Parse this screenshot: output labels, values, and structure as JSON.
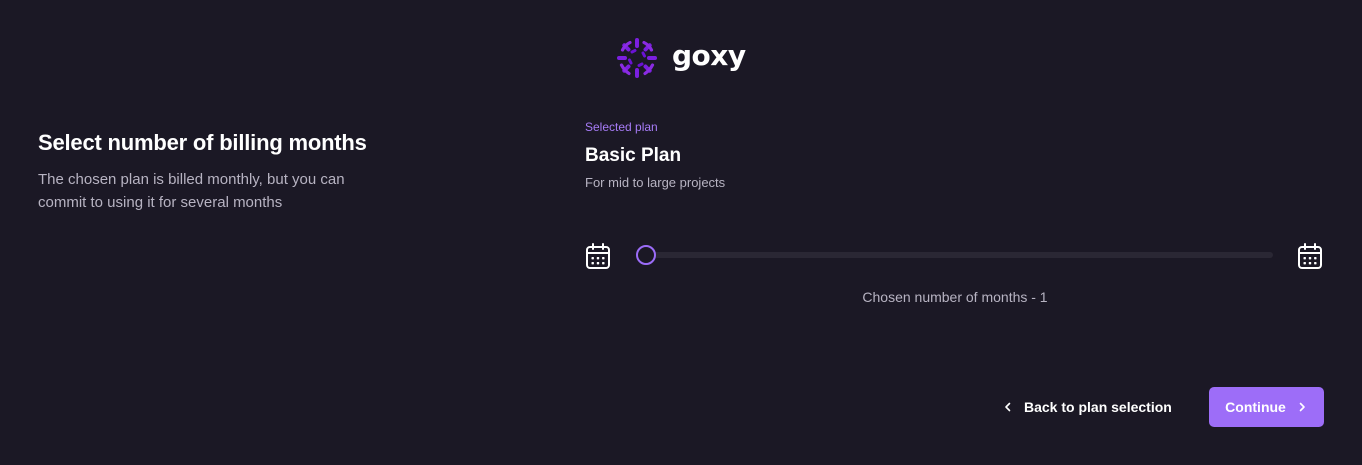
{
  "brand": {
    "name": "goxy",
    "logo_icon": "goxy-logo-icon",
    "accent_color": "#8b5cf6"
  },
  "intro": {
    "title": "Select number of billing months",
    "description": "The chosen plan is billed monthly, but you can commit to using it for several months"
  },
  "plan": {
    "kicker": "Selected plan",
    "name": "Basic Plan",
    "description": "For mid to large projects"
  },
  "slider": {
    "min_icon": "calendar-icon",
    "max_icon": "calendar-icon",
    "value_fraction": 0,
    "label": "Chosen number of months - 1"
  },
  "actions": {
    "back_label": "Back to plan selection",
    "continue_label": "Continue"
  }
}
